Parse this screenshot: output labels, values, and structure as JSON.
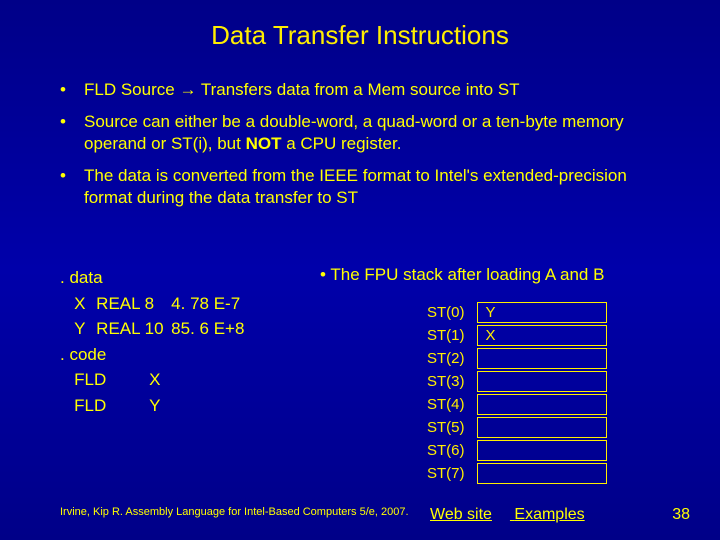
{
  "title": "Data Transfer Instructions",
  "bullets": {
    "b1a": "FLD Source ",
    "b1arrow": "→",
    "b1b": " Transfers data from a Mem source into ST",
    "b2a": "Source can either be a double-word, a quad-word or a ten-byte memory operand or ST(i), but ",
    "b2bold": "NOT",
    "b2b": " a CPU register.",
    "b3": "The data is converted from the IEEE format to Intel's extended-precision format during the data transfer to ST"
  },
  "code": {
    "l1": ". data",
    "l2a": "X",
    "l2b": "REAL 8",
    "l2c": "4. 78 E-7",
    "l3a": "Y",
    "l3b": "REAL 10",
    "l3c": "85. 6 E+8",
    "l4": ". code",
    "l5a": "FLD",
    "l5b": "X",
    "l6a": "FLD",
    "l6b": "Y"
  },
  "stack": {
    "caption": "• The FPU stack after loading A and B",
    "rows": [
      {
        "label": "ST(0)",
        "val": "Y"
      },
      {
        "label": "ST(1)",
        "val": "X"
      },
      {
        "label": "ST(2)",
        "val": ""
      },
      {
        "label": "ST(3)",
        "val": ""
      },
      {
        "label": "ST(4)",
        "val": ""
      },
      {
        "label": "ST(5)",
        "val": ""
      },
      {
        "label": "ST(6)",
        "val": ""
      },
      {
        "label": "ST(7)",
        "val": ""
      }
    ]
  },
  "footer": {
    "cite": "Irvine, Kip R. Assembly Language for Intel-Based Computers 5/e, 2007.",
    "link1": "Web site",
    "link2": "Examples",
    "page": "38"
  }
}
